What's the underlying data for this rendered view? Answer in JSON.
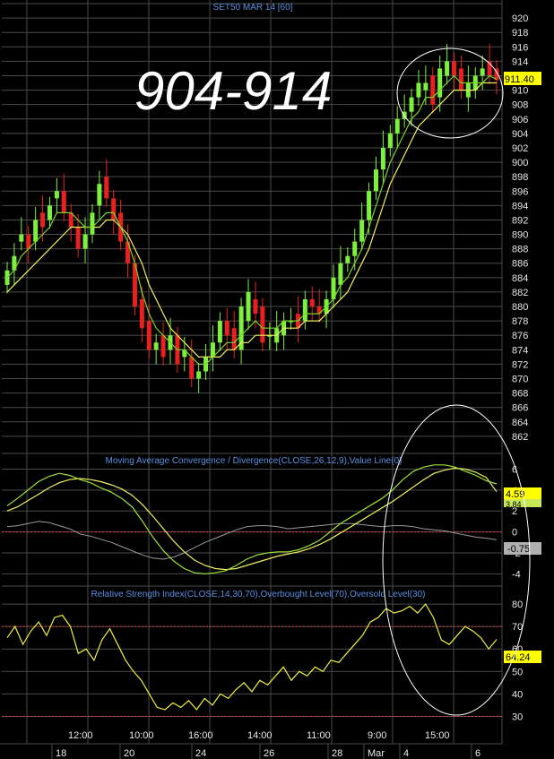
{
  "overlay_text": "904-914",
  "colors": {
    "background": "#000000",
    "grid": "#4a4a4a",
    "up_candle": "#7cf03c",
    "down_candle": "#e82020",
    "ma_fast": "#7ad42a",
    "ma_slow": "#f0f060",
    "macd_line": "#9de03a",
    "signal_line": "#f0f060",
    "histogram_line": "#9a9a9a",
    "rsi_line": "#f0f040",
    "level_line": "#e04040",
    "title_text": "#5b8fe0",
    "axis_text": "#e8e8e8",
    "highlight_box": "#ffff00",
    "ellipse": "#ffffff"
  },
  "time_axis": {
    "labels": [
      "12:00",
      "10:00",
      "16:00",
      "14:00",
      "11:00",
      "9:00",
      "15:00"
    ],
    "date_labels": [
      "18",
      "20",
      "24",
      "26",
      "28",
      "Mar",
      "4",
      "6"
    ]
  },
  "chart_data": [
    {
      "type": "candlestick",
      "title": "SET50 MAR 14   [60]",
      "ylim": [
        860,
        922
      ],
      "y_ticks": [
        "920",
        "918",
        "916",
        "914",
        "912",
        "910",
        "908",
        "906",
        "904",
        "902",
        "900",
        "898",
        "896",
        "894",
        "892",
        "890",
        "888",
        "886",
        "884",
        "882",
        "880",
        "878",
        "876",
        "874",
        "872",
        "870",
        "868",
        "866",
        "864",
        "862"
      ],
      "last_price_label": "911.40",
      "last_price": 911.4,
      "close": [
        885,
        887,
        890,
        888,
        892,
        891,
        894,
        896,
        893,
        891,
        888,
        890,
        893,
        897,
        895,
        892,
        889,
        886,
        880,
        877,
        874,
        875,
        873,
        876,
        872,
        874,
        870,
        871,
        873,
        875,
        878,
        876,
        874,
        880,
        882,
        879,
        875,
        876,
        877,
        878,
        878,
        877,
        881,
        880,
        879,
        881,
        884,
        886,
        887,
        889,
        892,
        896,
        899,
        902,
        904,
        906,
        907,
        909,
        911,
        911,
        908,
        913,
        914,
        912,
        910,
        911,
        912,
        913,
        912,
        911.4
      ],
      "open": [
        883,
        885,
        889,
        890,
        889,
        893,
        892,
        895,
        896,
        893,
        891,
        888,
        890,
        894,
        898,
        895,
        893,
        889,
        886,
        881,
        878,
        874,
        876,
        874,
        876,
        873,
        873,
        870,
        871,
        873,
        875,
        878,
        877,
        874,
        878,
        881,
        880,
        876,
        875,
        876,
        878,
        879,
        878,
        881,
        880,
        879,
        881,
        883,
        886,
        887,
        889,
        892,
        896,
        899,
        902,
        904,
        906,
        907,
        909,
        910,
        912,
        909,
        912,
        914,
        913,
        909,
        910,
        912,
        914,
        913
      ],
      "ma_fast": [
        884,
        885,
        887,
        888,
        889,
        890,
        891,
        893,
        893,
        893,
        892,
        891,
        891,
        892,
        893,
        893,
        891,
        889,
        886,
        882,
        879,
        877,
        876,
        875,
        874,
        874,
        873,
        872,
        872,
        873,
        874,
        875,
        875,
        876,
        877,
        878,
        877,
        877,
        877,
        878,
        878,
        878,
        879,
        879,
        879,
        880,
        881,
        883,
        884,
        886,
        888,
        891,
        894,
        897,
        900,
        902,
        904,
        906,
        907,
        909,
        909,
        910,
        911,
        912,
        911,
        911,
        911,
        911,
        912,
        911.5
      ],
      "ma_slow": [
        882,
        883,
        884,
        885,
        886,
        887,
        888,
        889,
        890,
        891,
        891,
        891,
        891,
        891,
        892,
        892,
        891,
        890,
        888,
        886,
        883,
        881,
        879,
        877,
        876,
        875,
        874,
        873,
        873,
        873,
        873,
        874,
        874,
        875,
        875,
        876,
        876,
        876,
        876,
        877,
        877,
        877,
        878,
        878,
        878,
        879,
        880,
        881,
        882,
        884,
        886,
        888,
        891,
        894,
        897,
        899,
        901,
        903,
        905,
        906,
        907,
        908,
        909,
        910,
        910,
        910,
        910,
        911,
        911,
        911
      ]
    },
    {
      "type": "line",
      "title": "Moving Average Convergence / Divergence(CLOSE,26,12,9),Value Line(0)",
      "ylim": [
        -5,
        7.5
      ],
      "y_ticks": [
        "6",
        "4",
        "2",
        "0",
        "-2",
        "-4"
      ],
      "value_labels": [
        "4.59",
        "3.84",
        "-0.75"
      ],
      "series": [
        {
          "name": "MACD",
          "values": [
            2.5,
            3.2,
            4.0,
            4.8,
            5.3,
            5.6,
            5.4,
            5.0,
            4.7,
            4.2,
            3.8,
            3.2,
            2.4,
            1.0,
            -0.5,
            -1.8,
            -2.8,
            -3.5,
            -3.9,
            -4.0,
            -3.9,
            -3.7,
            -3.2,
            -2.6,
            -2.2,
            -2.0,
            -1.9,
            -1.9,
            -1.7,
            -1.3,
            -0.8,
            0.0,
            0.8,
            1.4,
            2.0,
            2.6,
            3.2,
            4.0,
            5.0,
            5.8,
            6.2,
            6.4,
            6.4,
            6.2,
            5.8,
            5.4,
            4.9,
            4.59
          ]
        },
        {
          "name": "Signal",
          "values": [
            2.0,
            2.4,
            3.0,
            3.6,
            4.2,
            4.7,
            5.0,
            5.1,
            5.0,
            4.8,
            4.5,
            4.1,
            3.5,
            2.6,
            1.5,
            0.3,
            -0.9,
            -1.9,
            -2.7,
            -3.2,
            -3.5,
            -3.6,
            -3.5,
            -3.2,
            -2.9,
            -2.6,
            -2.3,
            -2.1,
            -1.9,
            -1.6,
            -1.2,
            -0.7,
            -0.1,
            0.5,
            1.1,
            1.7,
            2.3,
            2.9,
            3.6,
            4.3,
            5.0,
            5.6,
            5.9,
            6.1,
            6.0,
            5.7,
            5.2,
            3.84
          ]
        },
        {
          "name": "Histogram",
          "values": [
            0.5,
            0.6,
            0.8,
            1.0,
            0.9,
            0.6,
            0.3,
            -0.2,
            -0.4,
            -0.7,
            -1.0,
            -1.4,
            -1.8,
            -2.2,
            -2.5,
            -2.6,
            -2.4,
            -2.0,
            -1.5,
            -1.0,
            -0.6,
            -0.2,
            0.2,
            0.5,
            0.6,
            0.6,
            0.5,
            0.3,
            0.4,
            0.5,
            0.6,
            0.7,
            0.8,
            0.8,
            0.7,
            0.6,
            0.5,
            0.6,
            0.6,
            0.5,
            0.3,
            0.2,
            0.1,
            -0.1,
            -0.3,
            -0.5,
            -0.6,
            -0.75
          ]
        }
      ]
    },
    {
      "type": "line",
      "title": "Relative Strength Index(CLOSE,14,30,70),Overbought Level(70),Oversold Level(30)",
      "ylim": [
        25,
        88
      ],
      "y_ticks": [
        "80",
        "70",
        "60",
        "50",
        "40",
        "30"
      ],
      "levels": [
        70,
        30
      ],
      "value_label": "64.24",
      "series": [
        {
          "name": "RSI",
          "values": [
            65,
            70,
            62,
            68,
            72,
            66,
            74,
            75,
            70,
            58,
            60,
            55,
            64,
            69,
            62,
            55,
            50,
            46,
            40,
            34,
            33,
            36,
            34,
            37,
            33,
            38,
            35,
            40,
            38,
            42,
            45,
            41,
            46,
            44,
            48,
            52,
            46,
            50,
            48,
            52,
            50,
            55,
            54,
            58,
            62,
            66,
            72,
            74,
            78,
            76,
            77,
            79,
            76,
            80,
            74,
            64,
            62,
            66,
            70,
            68,
            65,
            60,
            64.24
          ]
        }
      ]
    }
  ]
}
